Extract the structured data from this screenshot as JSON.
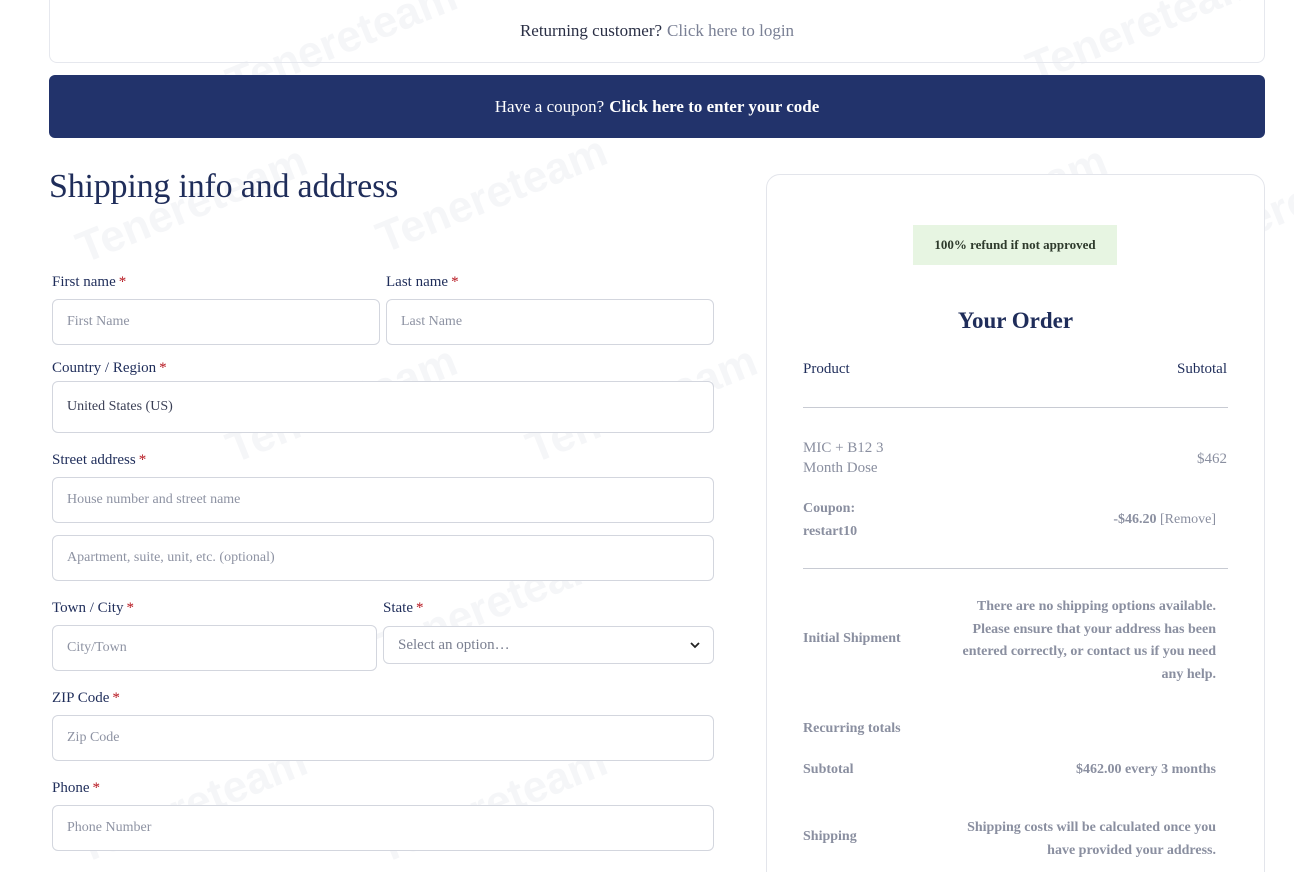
{
  "returning": {
    "question": "Returning customer?",
    "link": "Click here to login"
  },
  "coupon": {
    "question": "Have a coupon?",
    "link": "Click here to enter your code"
  },
  "shipping": {
    "title": "Shipping info and address",
    "required_mark": "*",
    "first_name": {
      "label": "First name",
      "placeholder": "First Name"
    },
    "last_name": {
      "label": "Last name",
      "placeholder": "Last Name"
    },
    "country": {
      "label": "Country / Region",
      "value": "United States (US)"
    },
    "street": {
      "label": "Street address",
      "placeholder": "House number and street name",
      "placeholder2": "Apartment, suite, unit, etc. (optional)"
    },
    "city": {
      "label": "Town / City",
      "placeholder": "City/Town"
    },
    "state": {
      "label": "State",
      "selected": "Select an option…"
    },
    "zip": {
      "label": "ZIP Code",
      "placeholder": "Zip Code"
    },
    "phone": {
      "label": "Phone",
      "placeholder": "Phone Number"
    }
  },
  "order": {
    "badge": "100% refund if not approved",
    "title": "Your Order",
    "col_product": "Product",
    "col_subtotal": "Subtotal",
    "item_name_line1": "MIC + B12 3",
    "item_name_line2": "Month Dose",
    "item_price": "$462",
    "coupon_label_line1": "Coupon:",
    "coupon_label_line2": "restart10",
    "coupon_amount": "-$46.20",
    "coupon_remove": "[Remove]",
    "initial_shipment_label": "Initial Shipment",
    "shipping_notice": [
      "There are no shipping options available.",
      "Please ensure that your address has been",
      "entered correctly, or contact us if you need",
      "any help."
    ],
    "recurring_label": "Recurring totals",
    "subtotal_label": "Subtotal",
    "subtotal_value": "$462.00 every 3 months",
    "shipping_label": "Shipping",
    "shipping_calc": [
      "Shipping costs will be calculated once you",
      "have provided your address."
    ]
  },
  "watermark": "Tenereteam",
  "colors": {
    "primary": "#22336b",
    "badge_bg": "#e7f5e2",
    "required": "#b5121b"
  },
  "icons": {
    "select_arrow": "chevron-down-icon"
  }
}
